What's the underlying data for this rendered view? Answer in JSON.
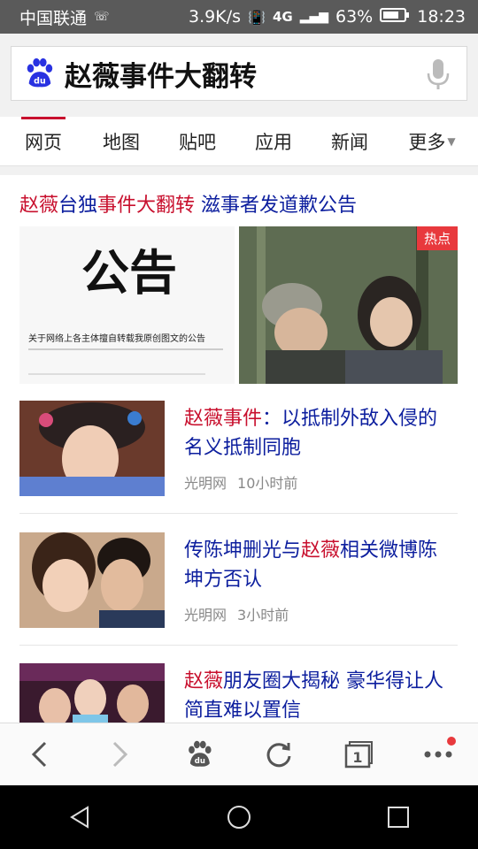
{
  "status": {
    "carrier": "中国联通",
    "speed": "3.9K/s",
    "network": "4G",
    "battery": "63%",
    "time": "18:23"
  },
  "search": {
    "query": "赵薇事件大翻转"
  },
  "tabs": [
    {
      "label": "网页"
    },
    {
      "label": "地图"
    },
    {
      "label": "贴吧"
    },
    {
      "label": "应用"
    },
    {
      "label": "新闻"
    },
    {
      "label": "更多"
    }
  ],
  "featured": {
    "headline_parts": [
      "赵薇",
      "台独",
      "事件大翻转",
      " 滋事者发道歉公告"
    ],
    "notice_title": "公告",
    "notice_caption": "关于网络上各主体擅自转载我原创图文的公告",
    "hot_badge": "热点"
  },
  "articles": [
    {
      "title_hl": "赵薇事件",
      "title_rest": "：以抵制外敌入侵的名义抵制同胞",
      "title_pre": "",
      "source": "光明网",
      "time": "10小时前"
    },
    {
      "title_pre": "传陈坤删光与",
      "title_hl": "赵薇",
      "title_rest": "相关微博陈坤方否认",
      "source": "光明网",
      "time": "3小时前"
    },
    {
      "title_pre": "",
      "title_hl": "赵薇",
      "title_rest": "朋友圈大揭秘 豪华得让人简直难以置信",
      "source": "",
      "time": ""
    }
  ],
  "colors": {
    "accent": "#c8102e",
    "link": "#0c1e9e",
    "baidu_blue": "#2932e1"
  }
}
